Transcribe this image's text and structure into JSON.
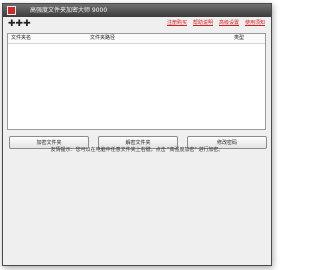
{
  "window": {
    "title": "高强度文件夹加密大师 9000"
  },
  "toolbar": {
    "logo": "✚✚✚",
    "links": [
      "注册购买",
      "帮助说明",
      "高级设置",
      "使用须知"
    ]
  },
  "list": {
    "columns": [
      "文件夹名",
      "文件夹路径",
      "类型"
    ]
  },
  "buttons": {
    "encrypt_label": "加密文件夹",
    "decrypt_label": "解密文件夹",
    "password_label": "修改密码"
  },
  "footer": {
    "tip": "友情提示：您可以在电脑中任意文件夹上右键，点击 \"高强度加密\" 进行加密。"
  },
  "colors": {
    "link": "#d22121",
    "titlebar": "#4b4b4b"
  }
}
